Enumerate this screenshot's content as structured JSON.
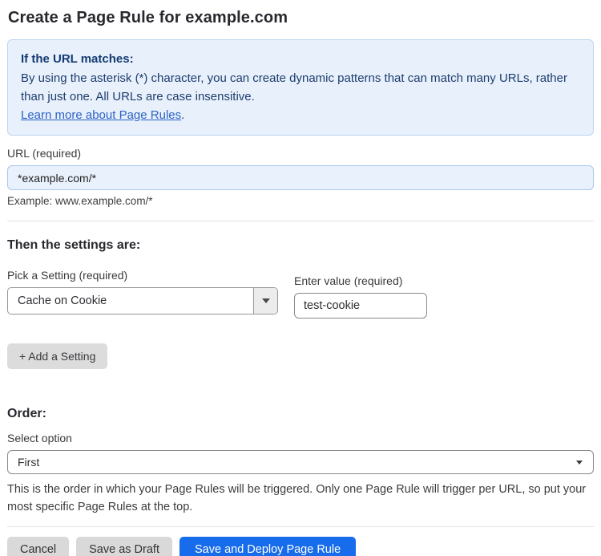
{
  "page": {
    "title": "Create a Page Rule for example.com"
  },
  "info_box": {
    "heading": "If the URL matches:",
    "body": "By using the asterisk (*) character, you can create dynamic patterns that can match many URLs, rather than just one. All URLs are case insensitive.",
    "link_label": "Learn more about Page Rules",
    "link_suffix": "."
  },
  "url_field": {
    "label": "URL (required)",
    "value": "*example.com/*",
    "example": "Example: www.example.com/*"
  },
  "settings_section": {
    "heading": "Then the settings are:",
    "setting_picker": {
      "label": "Pick a Setting (required)",
      "selected": "Cache on Cookie"
    },
    "value_field": {
      "label": "Enter value (required)",
      "value": "test-cookie"
    },
    "add_setting_label": "+ Add a Setting"
  },
  "order_section": {
    "heading": "Order:",
    "select_label": "Select option",
    "selected": "First",
    "help_text": "This is the order in which your Page Rules will be triggered. Only one Page Rule will trigger per URL, so put your most specific Page Rules at the top."
  },
  "footer": {
    "cancel_label": "Cancel",
    "save_draft_label": "Save as Draft",
    "save_deploy_label": "Save and Deploy Page Rule"
  },
  "colors": {
    "accent_blue": "#166ceb",
    "info_bg": "#e8f1fb",
    "info_border": "#bcd5f0",
    "info_text": "#1e3c6e",
    "link_blue": "#2d62c4",
    "url_input_bg": "#e9f1fc",
    "url_input_border": "#abc7ea",
    "button_gray": "#d9d9d9"
  }
}
